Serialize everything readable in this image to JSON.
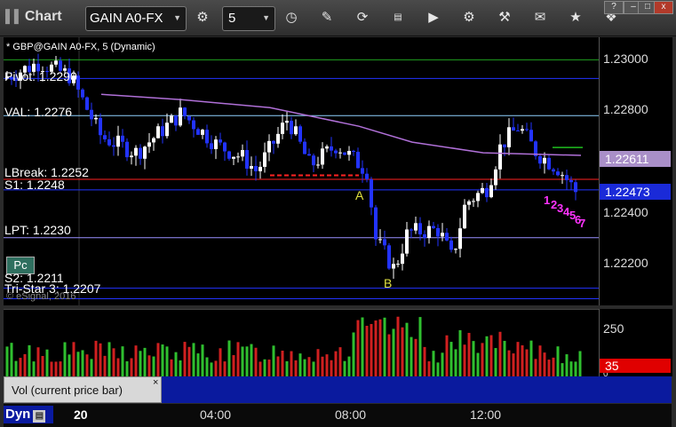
{
  "toolbar": {
    "title": "Chart",
    "symbol": "GAIN A0-FX",
    "interval": "5",
    "icons": [
      "settings-icon",
      "clock-icon",
      "pencil-icon",
      "refresh-icon",
      "get-icon",
      "play-icon",
      "gear-icon",
      "tools-icon",
      "comment-icon",
      "twitter-icon"
    ],
    "window_buttons": [
      "?",
      "–",
      "□",
      "x"
    ]
  },
  "chart": {
    "header": "* GBP@GAIN A0-FX, 5 (Dynamic)",
    "watermark": "© eSignal, 2016",
    "levels": [
      {
        "label": "Pivot: 1.2290",
        "price": 1.229,
        "color": "#2233ff"
      },
      {
        "label": "VAL: 1.2276",
        "price": 1.2276,
        "color": "#8fd3ff"
      },
      {
        "label": "LBreak: 1.2252",
        "price": 1.2252,
        "color": "#ff2222"
      },
      {
        "label": "S1: 1.2248",
        "price": 1.2248,
        "color": "#2233ff"
      },
      {
        "label": "LPT: 1.2230",
        "price": 1.223,
        "color": "#9a8fff"
      },
      {
        "label": "S2: 1.2211",
        "price": 1.2211,
        "color": "#2233ff"
      },
      {
        "label": "Tri-Star 3: 1.2207",
        "price": 1.2207,
        "color": "#2233ff"
      }
    ],
    "top_green_price": 1.2297,
    "annotations": {
      "A": "A",
      "B": "B"
    },
    "counts_magenta": [
      "1",
      "2",
      "3",
      "4",
      "5",
      "6",
      "7"
    ],
    "pc_button": "Pc"
  },
  "price_axis": {
    "ticks": [
      "1.23000",
      "1.22800",
      "1.22600",
      "1.22400",
      "1.22200"
    ],
    "tick_values": [
      1.23,
      1.228,
      1.226,
      1.224,
      1.222
    ],
    "range": [
      1.22045,
      1.23055
    ],
    "current_purple": "1.22611",
    "current_blue": "1.22473"
  },
  "volume": {
    "ticks": [
      "250",
      "0"
    ],
    "current": "35",
    "label": "Vol (current price bar)",
    "close_label": "×"
  },
  "time_axis": {
    "left_label": "Dyn",
    "labels": [
      "20",
      "04:00",
      "08:00",
      "12:00"
    ]
  },
  "colors": {
    "candle_up": "#ffffff",
    "candle_down": "#2233ff",
    "ma_line": "#b070d8",
    "vol_up": "#2fbf2f",
    "vol_down": "#d02020",
    "setup_green": "#2f9f2f",
    "count_magenta": "#ff33ff"
  }
}
